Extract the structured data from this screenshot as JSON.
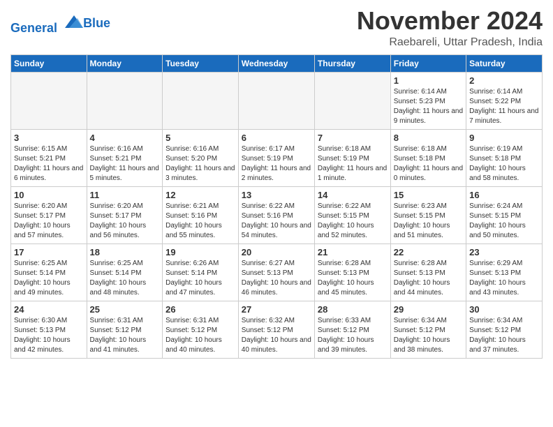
{
  "header": {
    "logo_line1": "General",
    "logo_line2": "Blue",
    "month_title": "November 2024",
    "location": "Raebareli, Uttar Pradesh, India"
  },
  "weekdays": [
    "Sunday",
    "Monday",
    "Tuesday",
    "Wednesday",
    "Thursday",
    "Friday",
    "Saturday"
  ],
  "weeks": [
    [
      {
        "day": "",
        "info": ""
      },
      {
        "day": "",
        "info": ""
      },
      {
        "day": "",
        "info": ""
      },
      {
        "day": "",
        "info": ""
      },
      {
        "day": "",
        "info": ""
      },
      {
        "day": "1",
        "info": "Sunrise: 6:14 AM\nSunset: 5:23 PM\nDaylight: 11 hours and 9 minutes."
      },
      {
        "day": "2",
        "info": "Sunrise: 6:14 AM\nSunset: 5:22 PM\nDaylight: 11 hours and 7 minutes."
      }
    ],
    [
      {
        "day": "3",
        "info": "Sunrise: 6:15 AM\nSunset: 5:21 PM\nDaylight: 11 hours and 6 minutes."
      },
      {
        "day": "4",
        "info": "Sunrise: 6:16 AM\nSunset: 5:21 PM\nDaylight: 11 hours and 5 minutes."
      },
      {
        "day": "5",
        "info": "Sunrise: 6:16 AM\nSunset: 5:20 PM\nDaylight: 11 hours and 3 minutes."
      },
      {
        "day": "6",
        "info": "Sunrise: 6:17 AM\nSunset: 5:19 PM\nDaylight: 11 hours and 2 minutes."
      },
      {
        "day": "7",
        "info": "Sunrise: 6:18 AM\nSunset: 5:19 PM\nDaylight: 11 hours and 1 minute."
      },
      {
        "day": "8",
        "info": "Sunrise: 6:18 AM\nSunset: 5:18 PM\nDaylight: 11 hours and 0 minutes."
      },
      {
        "day": "9",
        "info": "Sunrise: 6:19 AM\nSunset: 5:18 PM\nDaylight: 10 hours and 58 minutes."
      }
    ],
    [
      {
        "day": "10",
        "info": "Sunrise: 6:20 AM\nSunset: 5:17 PM\nDaylight: 10 hours and 57 minutes."
      },
      {
        "day": "11",
        "info": "Sunrise: 6:20 AM\nSunset: 5:17 PM\nDaylight: 10 hours and 56 minutes."
      },
      {
        "day": "12",
        "info": "Sunrise: 6:21 AM\nSunset: 5:16 PM\nDaylight: 10 hours and 55 minutes."
      },
      {
        "day": "13",
        "info": "Sunrise: 6:22 AM\nSunset: 5:16 PM\nDaylight: 10 hours and 54 minutes."
      },
      {
        "day": "14",
        "info": "Sunrise: 6:22 AM\nSunset: 5:15 PM\nDaylight: 10 hours and 52 minutes."
      },
      {
        "day": "15",
        "info": "Sunrise: 6:23 AM\nSunset: 5:15 PM\nDaylight: 10 hours and 51 minutes."
      },
      {
        "day": "16",
        "info": "Sunrise: 6:24 AM\nSunset: 5:15 PM\nDaylight: 10 hours and 50 minutes."
      }
    ],
    [
      {
        "day": "17",
        "info": "Sunrise: 6:25 AM\nSunset: 5:14 PM\nDaylight: 10 hours and 49 minutes."
      },
      {
        "day": "18",
        "info": "Sunrise: 6:25 AM\nSunset: 5:14 PM\nDaylight: 10 hours and 48 minutes."
      },
      {
        "day": "19",
        "info": "Sunrise: 6:26 AM\nSunset: 5:14 PM\nDaylight: 10 hours and 47 minutes."
      },
      {
        "day": "20",
        "info": "Sunrise: 6:27 AM\nSunset: 5:13 PM\nDaylight: 10 hours and 46 minutes."
      },
      {
        "day": "21",
        "info": "Sunrise: 6:28 AM\nSunset: 5:13 PM\nDaylight: 10 hours and 45 minutes."
      },
      {
        "day": "22",
        "info": "Sunrise: 6:28 AM\nSunset: 5:13 PM\nDaylight: 10 hours and 44 minutes."
      },
      {
        "day": "23",
        "info": "Sunrise: 6:29 AM\nSunset: 5:13 PM\nDaylight: 10 hours and 43 minutes."
      }
    ],
    [
      {
        "day": "24",
        "info": "Sunrise: 6:30 AM\nSunset: 5:13 PM\nDaylight: 10 hours and 42 minutes."
      },
      {
        "day": "25",
        "info": "Sunrise: 6:31 AM\nSunset: 5:12 PM\nDaylight: 10 hours and 41 minutes."
      },
      {
        "day": "26",
        "info": "Sunrise: 6:31 AM\nSunset: 5:12 PM\nDaylight: 10 hours and 40 minutes."
      },
      {
        "day": "27",
        "info": "Sunrise: 6:32 AM\nSunset: 5:12 PM\nDaylight: 10 hours and 40 minutes."
      },
      {
        "day": "28",
        "info": "Sunrise: 6:33 AM\nSunset: 5:12 PM\nDaylight: 10 hours and 39 minutes."
      },
      {
        "day": "29",
        "info": "Sunrise: 6:34 AM\nSunset: 5:12 PM\nDaylight: 10 hours and 38 minutes."
      },
      {
        "day": "30",
        "info": "Sunrise: 6:34 AM\nSunset: 5:12 PM\nDaylight: 10 hours and 37 minutes."
      }
    ]
  ]
}
